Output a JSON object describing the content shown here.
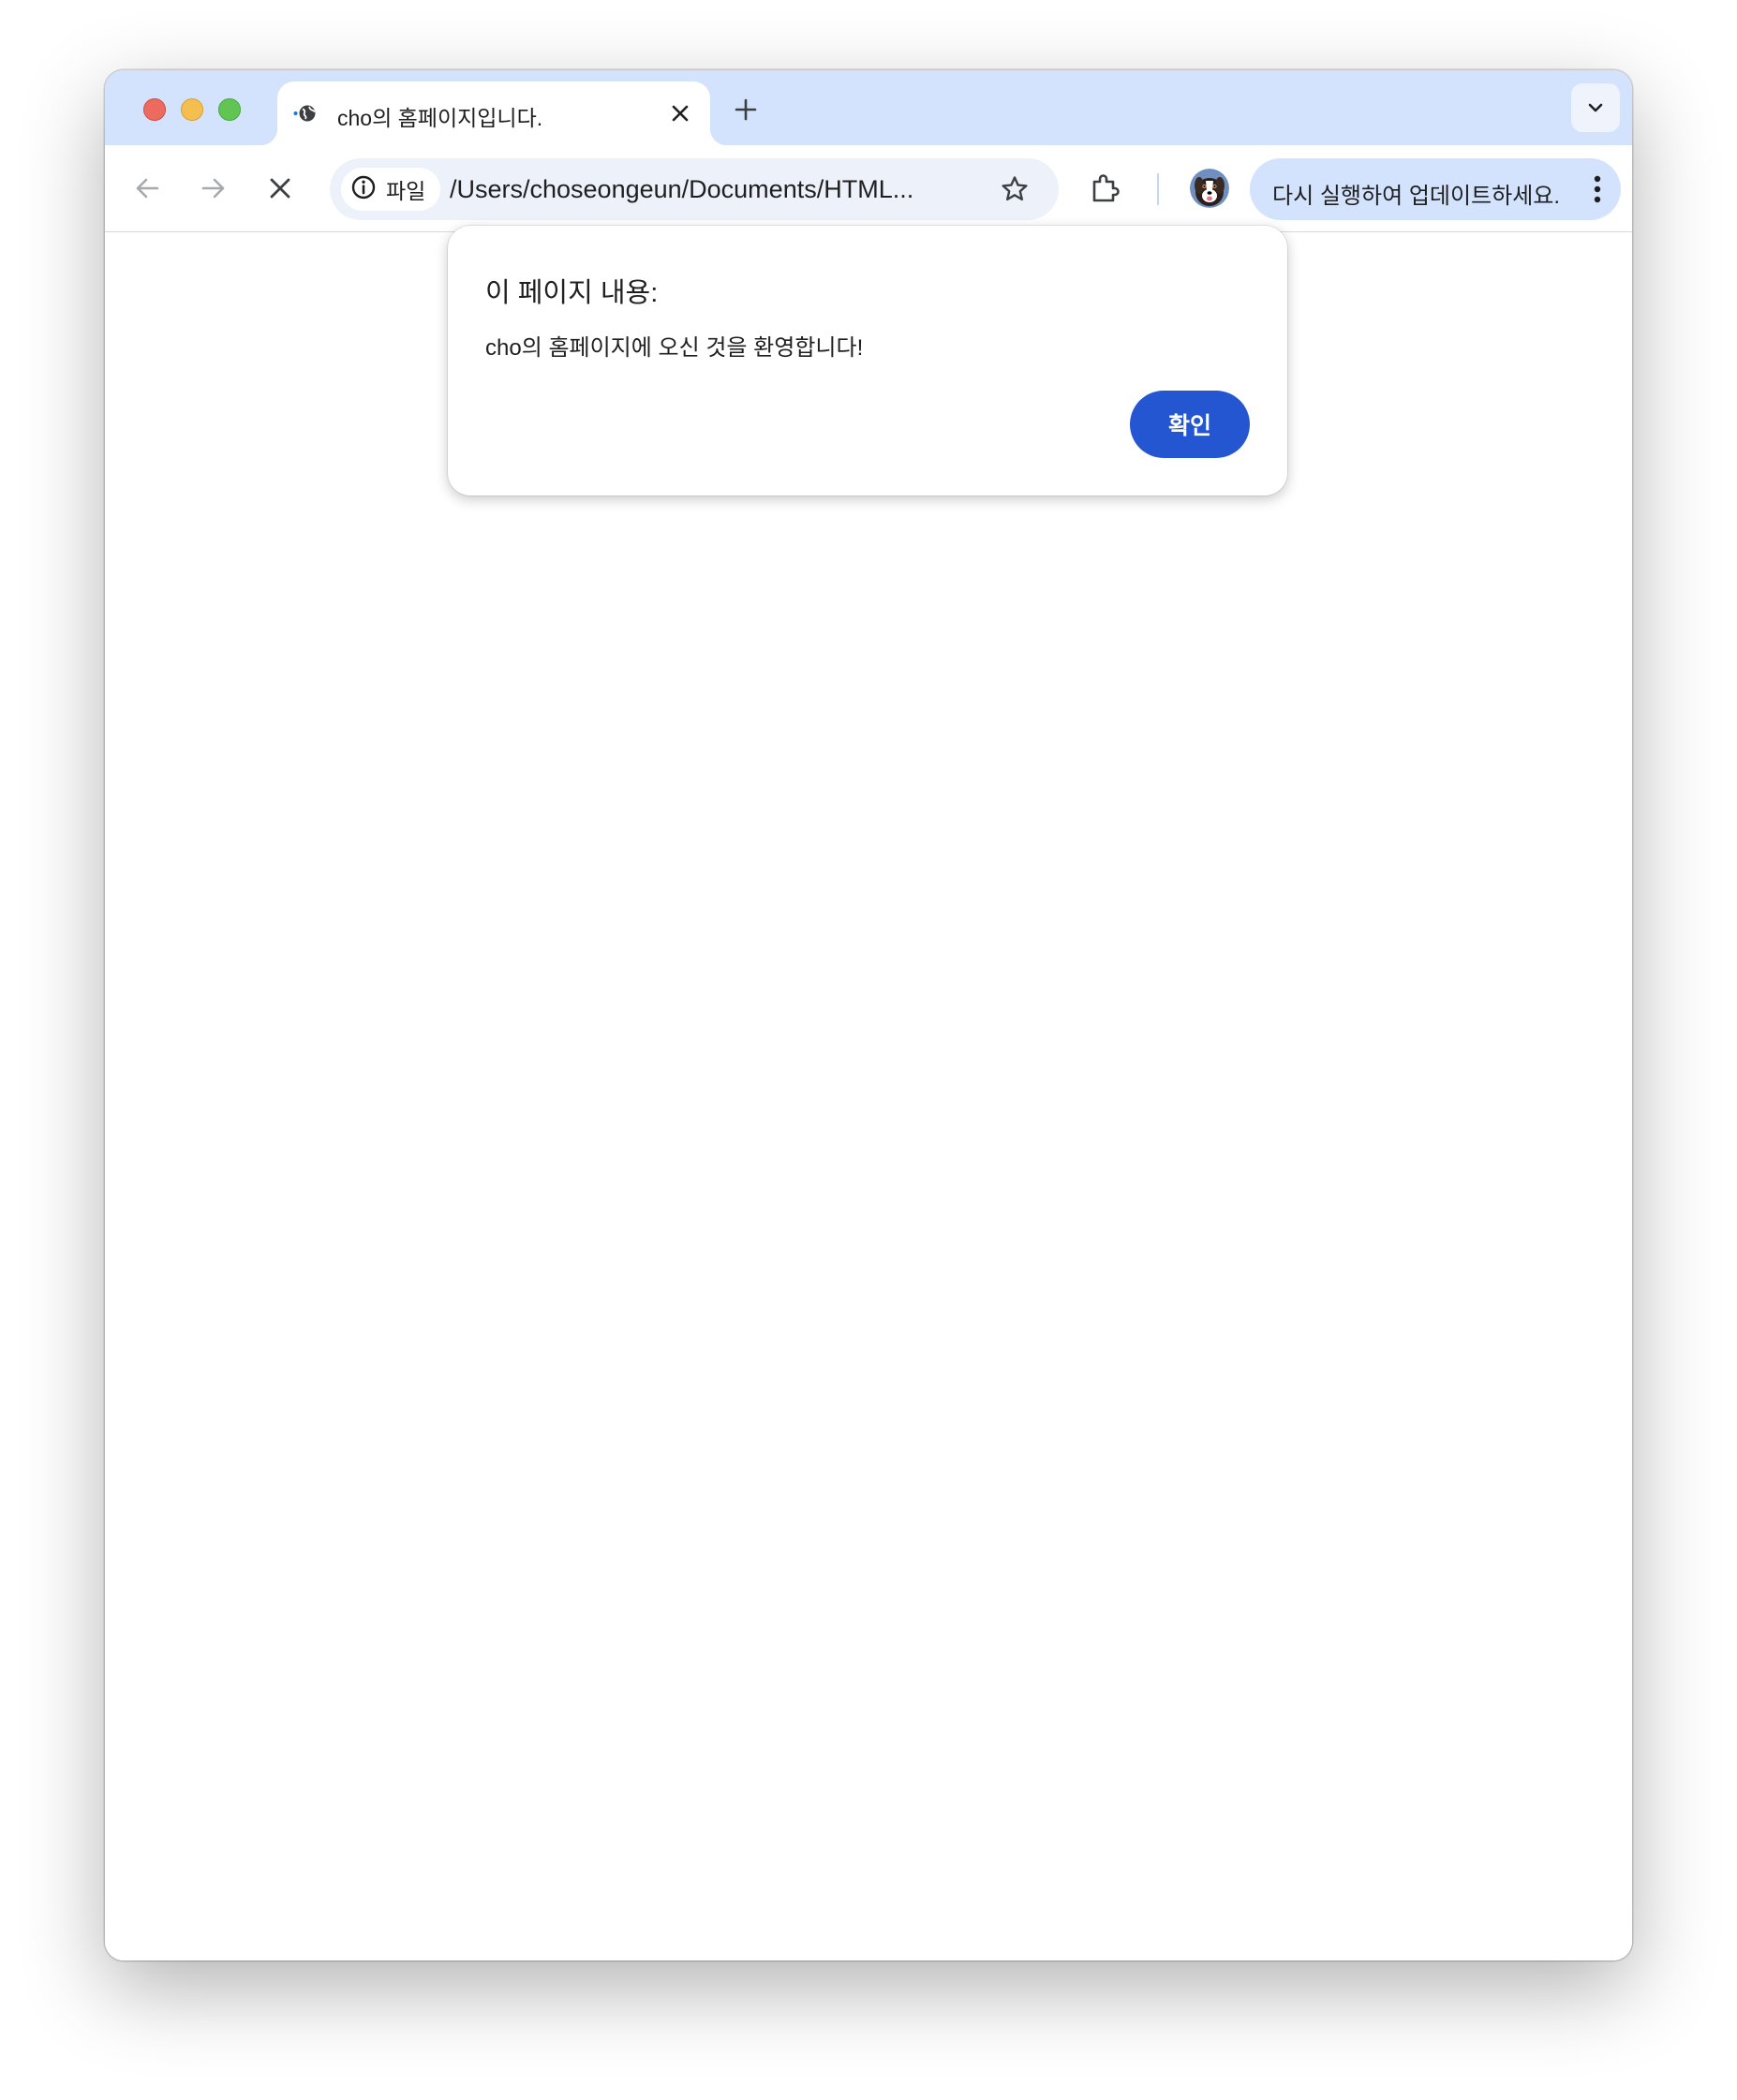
{
  "window": {
    "traffic_lights": [
      "close",
      "minimize",
      "maximize"
    ]
  },
  "tabs": [
    {
      "title": "cho의 홈페이지입니다.",
      "icon": "globe-loading-icon",
      "active": true
    }
  ],
  "toolbar": {
    "back_icon": "arrow-left-icon",
    "forward_icon": "arrow-right-icon",
    "stop_icon": "close-x-icon",
    "site_chip_label": "파일",
    "site_chip_icon": "info-circle-icon",
    "url": "/Users/choseongeun/Documents/HTML...",
    "bookmark_icon": "star-outline-icon",
    "extensions_icon": "puzzle-icon",
    "profile_icon": "avatar-dog",
    "update_label": "다시 실행하여 업데이트하세요.",
    "menu_icon": "vertical-dots-icon"
  },
  "dialog": {
    "title": "이 페이지 내용:",
    "message": "cho의 홈페이지에 오신 것을 환영합니다!",
    "ok_label": "확인"
  },
  "colors": {
    "tabstrip_bg": "#d3e3fd",
    "omnibox_bg": "#edf2fa",
    "update_pill_bg": "#d3e3fd",
    "ok_button_bg": "#2456d1",
    "traffic_close": "#ed6a5e",
    "traffic_minimize": "#f4bf4f",
    "traffic_maximize": "#61c554"
  }
}
